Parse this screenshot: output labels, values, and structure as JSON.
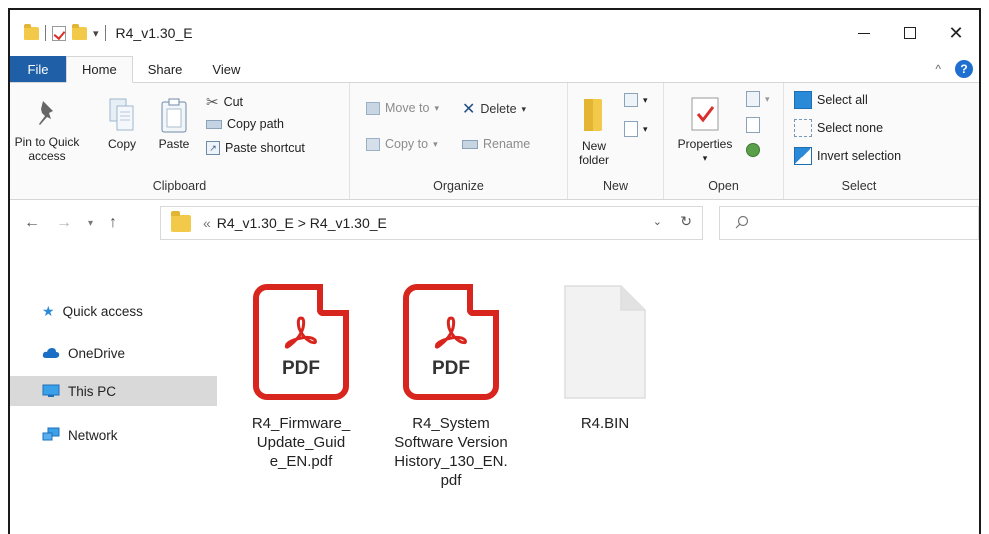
{
  "window": {
    "title": "R4_v1.30_E",
    "controls": {
      "minimize": "minimize",
      "maximize": "maximize",
      "close": "✕"
    }
  },
  "tabs": [
    {
      "label": "File"
    },
    {
      "label": "Home"
    },
    {
      "label": "Share"
    },
    {
      "label": "View"
    }
  ],
  "ribbon": {
    "clipboard": {
      "label": "Clipboard",
      "pin_line1": "Pin to Quick",
      "pin_line2": "access",
      "copy": "Copy",
      "paste": "Paste",
      "cut": "Cut",
      "copy_path": "Copy path",
      "paste_shortcut": "Paste shortcut"
    },
    "organize": {
      "label": "Organize",
      "move_to": "Move to",
      "copy_to": "Copy to",
      "delete": "Delete",
      "rename": "Rename"
    },
    "new": {
      "label": "New",
      "new_folder_line1": "New",
      "new_folder_line2": "folder"
    },
    "open": {
      "label": "Open",
      "properties": "Properties"
    },
    "select": {
      "label": "Select",
      "select_all": "Select all",
      "select_none": "Select none",
      "invert_selection": "Invert selection"
    }
  },
  "address": {
    "prefix": "«",
    "path": "R4_v1.30_E > R4_v1.30_E"
  },
  "nav": [
    {
      "label": "Quick access",
      "icon": "star-icon"
    },
    {
      "label": "OneDrive",
      "icon": "cloud-icon"
    },
    {
      "label": "This PC",
      "icon": "monitor-icon",
      "selected": true
    },
    {
      "label": "Network",
      "icon": "network-icon"
    }
  ],
  "files": [
    {
      "name_lines": [
        "R4_Firmware_",
        "Update_Guid",
        "e_EN.pdf"
      ],
      "type": "pdf",
      "badge": "PDF"
    },
    {
      "name_lines": [
        "R4_System",
        "Software Version",
        "History_130_EN.",
        "pdf"
      ],
      "type": "pdf",
      "badge": "PDF"
    },
    {
      "name_lines": [
        "R4.BIN"
      ],
      "type": "generic"
    }
  ],
  "colors": {
    "file_tab": "#1f5fa8",
    "pdf_red": "#d8261f",
    "folder_yellow": "#f3c94a",
    "selection_gray": "#d9d9d9"
  }
}
